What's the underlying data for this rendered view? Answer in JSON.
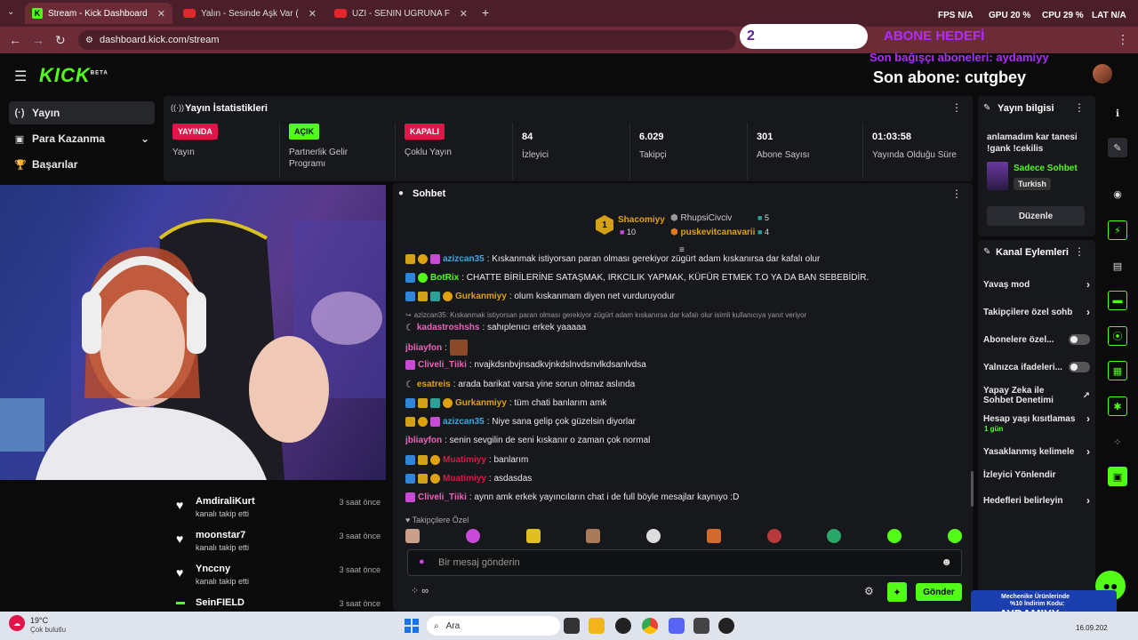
{
  "browser": {
    "tabs": [
      {
        "title": "Stream - Kick Dashboard",
        "close": "✕"
      },
      {
        "title": "Yalın - Sesinde Aşk Var ( Mahs",
        "close": "✕"
      },
      {
        "title": "UZI - SENIN UGRUNA FT MAVI - Y",
        "close": "✕"
      }
    ],
    "new_tab": "+",
    "url": "dashboard.kick.com/stream",
    "stats": {
      "fps_label": "FPS",
      "fps": "N/A",
      "gpu_label": "GPU",
      "gpu": "20 %",
      "cpu_label": "CPU",
      "cpu": "29 %",
      "lat_label": "LAT",
      "lat": "N/A"
    }
  },
  "overlay": {
    "goal_count": "2",
    "goal_title": "ABONE HEDEFİ",
    "last_donor": "Son bağışçı aboneleri: aydamiyy",
    "last_sub": "Son abone: cutgbey"
  },
  "header": {
    "logo": "KICK",
    "beta": "BETA"
  },
  "sidebar": {
    "items": [
      {
        "label": "Yayın",
        "icon": "(·)"
      },
      {
        "label": "Para Kazanma",
        "icon": "▣",
        "chev": "⌄"
      },
      {
        "label": "Başarılar",
        "icon": "🏆"
      }
    ]
  },
  "stats_panel": {
    "title": "Yayın İstatistikleri",
    "menu": "⋮",
    "cells": [
      {
        "badge": "YAYINDA",
        "label": "Yayın",
        "color": "#e0164a"
      },
      {
        "badge": "AÇIK",
        "label": "Partnerlik Gelir Programı",
        "color": "#53fc18"
      },
      {
        "badge": "KAPALI",
        "label": "Çoklu Yayın",
        "color": "#e0164a"
      },
      {
        "value": "84",
        "label": "İzleyici"
      },
      {
        "value": "6.029",
        "label": "Takipçi"
      },
      {
        "value": "301",
        "label": "Abone Sayısı"
      },
      {
        "value": "01:03:58",
        "label": "Yayında Olduğu Süre"
      }
    ]
  },
  "followers": [
    {
      "name": "AmdiraliKurt",
      "sub": "kanalı takip etti",
      "time": "3 saat önce"
    },
    {
      "name": "moonstar7",
      "sub": "kanalı takip etti",
      "time": "3 saat önce"
    },
    {
      "name": "Ynccny",
      "sub": "kanalı takip etti",
      "time": "3 saat önce"
    },
    {
      "name": "SeinFIELD",
      "sub": "",
      "time": "3 saat önce"
    }
  ],
  "chat": {
    "title": "Sohbet",
    "menu": "⋮",
    "leaders": [
      {
        "rank": "1",
        "name": "Shacomiyy",
        "count": "10"
      },
      {
        "name": "RhupsiCivciv",
        "count": "5"
      },
      {
        "name": "puskevitcanavarii",
        "count": "4"
      }
    ],
    "messages": [
      {
        "user": "azizcan35",
        "color": "#3ea8e0",
        "text": ": Kıskanmak istiyorsan paran olması gerekiyor zügürt adam kıskanırsa dar kafalı olur"
      },
      {
        "user": "BotRix",
        "color": "#53fc18",
        "text": ": CHATTE BİRİLERİNE SATAŞMAK, IRKCILIK YAPMAK, KÜFÜR ETMEK T.O YA DA BAN SEBEBİDİR."
      },
      {
        "user": "Gurkanmiyy",
        "color": "#e0a10e",
        "text": ": olum kıskanmam diyen net vurduruyodur"
      },
      {
        "user": "",
        "color": "#999",
        "text": "azizcan35: Kıskanmak istiyorsan paran olması gerekiyor zügürt adam kıskanırsa dar kafalı olur isimli kullanıcıya yanıt veriyor"
      },
      {
        "user": "kadastroshshs",
        "color": "#e864b9",
        "text": ": sahıplenıcı erkek yaaaaa"
      },
      {
        "user": "jbliayfon",
        "color": "#e864b9",
        "text": ":"
      },
      {
        "user": "Cliveli_Tiiki",
        "color": "#e864b9",
        "text": ": nvajkdsnbvjnsadkvjnkdslnvdsnvlkdsanlvdsa"
      },
      {
        "user": "esatreis",
        "color": "#e0a10e",
        "text": ": arada barikat varsa yine sorun olmaz aslında"
      },
      {
        "user": "Gurkanmiyy",
        "color": "#e0a10e",
        "text": ": tüm chati banlarım amk"
      },
      {
        "user": "azizcan35",
        "color": "#3ea8e0",
        "text": ": Niye sana gelip çok güzelsin diyorlar"
      },
      {
        "user": "jbliayfon",
        "color": "#e864b9",
        "text": ": senin sevgilin de seni kıskanır o zaman çok normal"
      },
      {
        "user": "Muatimiyy",
        "color": "#e0164a",
        "text": ": banlarım"
      },
      {
        "user": "Muatimiyy",
        "color": "#e0164a",
        "text": ": asdasdas"
      },
      {
        "user": "Cliveli_Tiiki",
        "color": "#e864b9",
        "text": ": aynn amk erkek yayıncıların chat i de full böyle mesajlar kaynıyo :D"
      }
    ],
    "followers_only": "♥ Takipçilere Özel",
    "input_placeholder": "Bir mesaj gönderin",
    "send": "Gönder"
  },
  "stream_info": {
    "title": "Yayın bilgisi",
    "menu": "⋮",
    "stream_title": "anlamadım kar tanesi !gank !cekilis",
    "category": "Sadece Sohbet",
    "language": "Turkish",
    "edit": "Düzenle"
  },
  "channel_actions": {
    "title": "Kanal Eylemleri",
    "menu": "⋮",
    "items": [
      {
        "label": "Yavaş mod",
        "type": "chev"
      },
      {
        "label": "Takipçilere özel sohb",
        "type": "chev"
      },
      {
        "label": "Abonelere özel...",
        "type": "toggle"
      },
      {
        "label": "Yalnızca ifadeleri...",
        "type": "toggle"
      },
      {
        "label": "Yapay Zeka ile Sohbet Denetimi",
        "type": "ext"
      },
      {
        "label": "Hesap yaşı kısıtlamas",
        "type": "chev",
        "sub": "1 gün"
      },
      {
        "label": "Yasaklanmış kelimele",
        "type": "chev"
      },
      {
        "label": "İzleyici Yönlendir",
        "type": "none"
      },
      {
        "label": "Hedefleri belirleyin",
        "type": "chev"
      }
    ]
  },
  "taskbar": {
    "weather_temp": "19°C",
    "weather_text": "Çok bulutlu",
    "search": "Ara",
    "date": "16.09.202"
  },
  "promo": {
    "line1": "Mechenike Ürünlerinde",
    "line2": "%10 İndirim Kodu:",
    "code": "AYDAMIYY"
  }
}
